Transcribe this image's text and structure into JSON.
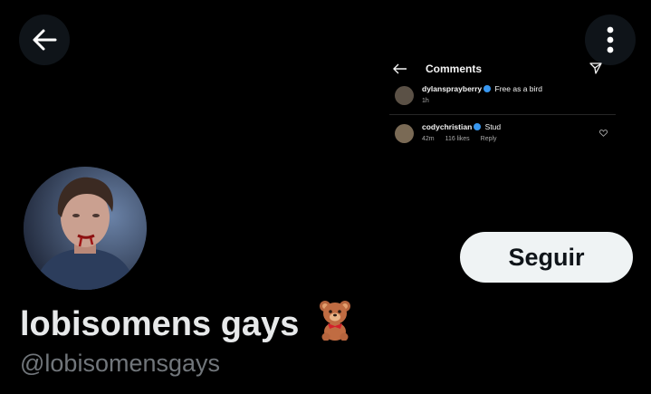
{
  "banner": {
    "comments_title": "Comments",
    "comment1": {
      "user": "dylansprayberry",
      "text": "Free as a bird",
      "time": "1h"
    },
    "comment2": {
      "user": "codychristian",
      "text": "Stud",
      "time": "42m",
      "likes": "116 likes",
      "reply": "Reply"
    }
  },
  "profile": {
    "follow_label": "Seguir",
    "display_name": "lobisomens gays",
    "handle": "@lobisomensgays"
  },
  "icons": {
    "back": "arrow-left-icon",
    "more": "more-vertical-icon",
    "bear": "teddy-bear-emoji-icon",
    "verified": "verified-badge-icon",
    "send": "send-icon",
    "heart": "heart-outline-icon"
  },
  "colors": {
    "background": "#000000",
    "follow_button": "#eff3f4",
    "handle_text": "#71767b",
    "verified": "#3897f0"
  }
}
